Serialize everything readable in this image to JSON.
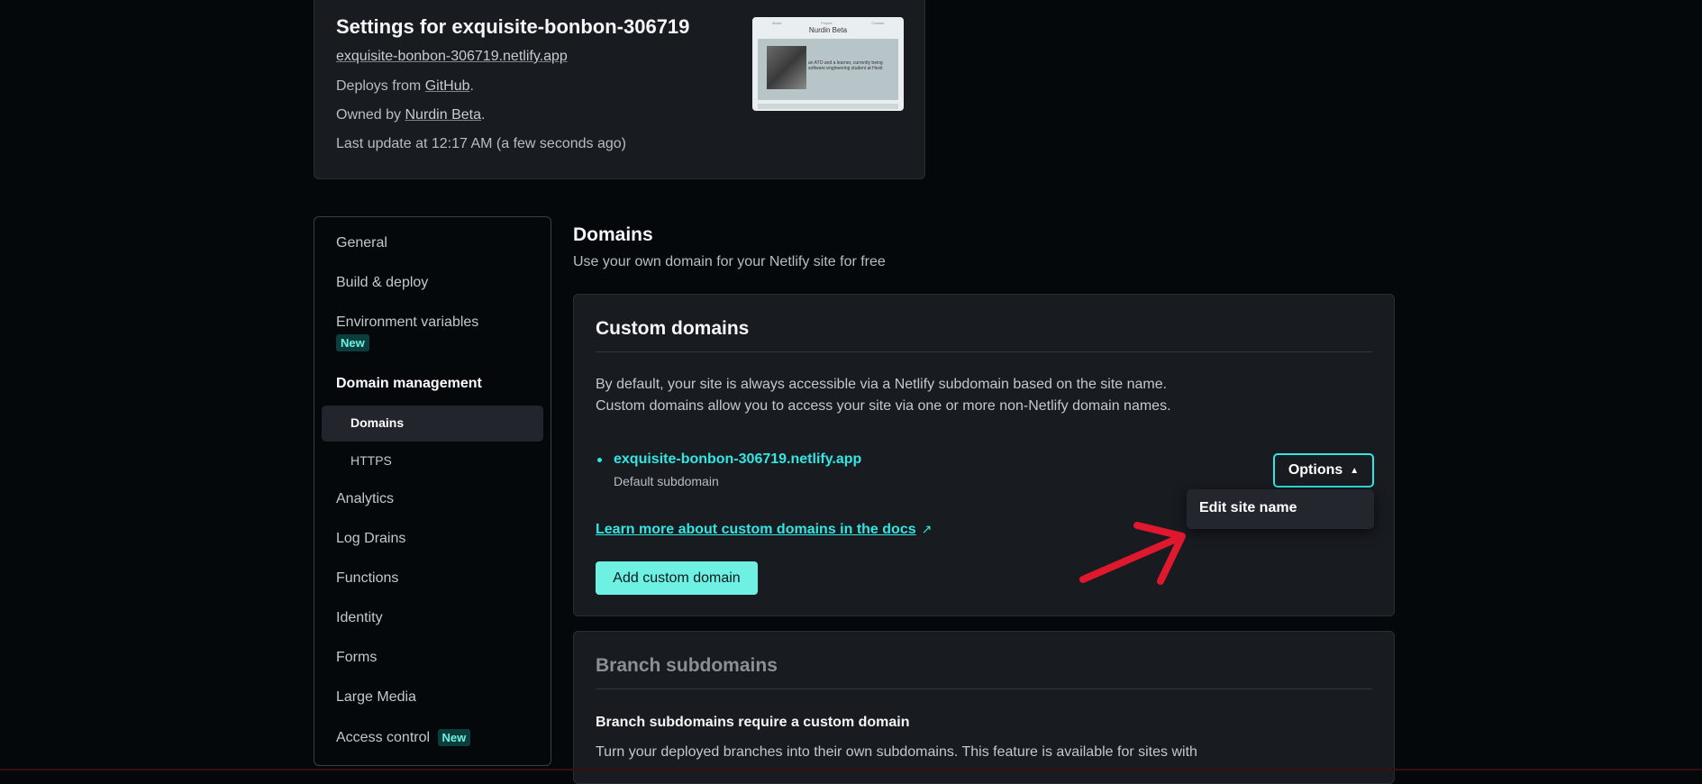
{
  "site": {
    "title": "Settings for exquisite-bonbon-306719",
    "url": "exquisite-bonbon-306719.netlify.app",
    "deploys_prefix": "Deploys from ",
    "deploys_source": "GitHub",
    "owned_prefix": "Owned by ",
    "owner": "Nurdin Beta",
    "period": ".",
    "last_update": "Last update at 12:17 AM (a few seconds ago)",
    "thumbnail": {
      "name": "Nurdin Beta",
      "nav": [
        "About",
        "Project",
        "Contact"
      ],
      "blurb": "an ATO and a learner, currently being software engineering student at Hexit"
    }
  },
  "sidebar": {
    "items": [
      {
        "label": "General"
      },
      {
        "label": "Build & deploy"
      },
      {
        "label": "Environment variables",
        "badge": "New"
      },
      {
        "label": "Domain management"
      },
      {
        "label": "Domains"
      },
      {
        "label": "HTTPS"
      },
      {
        "label": "Analytics"
      },
      {
        "label": "Log Drains"
      },
      {
        "label": "Functions"
      },
      {
        "label": "Identity"
      },
      {
        "label": "Forms"
      },
      {
        "label": "Large Media"
      },
      {
        "label": "Access control",
        "badge": "New"
      }
    ]
  },
  "main": {
    "title": "Domains",
    "subtitle": "Use your own domain for your Netlify site for free",
    "custom_domains": {
      "title": "Custom domains",
      "desc_line1": "By default, your site is always accessible via a Netlify subdomain based on the site name.",
      "desc_line2": "Custom domains allow you to access your site via one or more non-Netlify domain names.",
      "domain": "exquisite-bonbon-306719.netlify.app",
      "domain_note": "Default subdomain",
      "options_label": "Options",
      "menu_item": "Edit site name",
      "docs_link": "Learn more about custom domains in the docs",
      "add_button": "Add custom domain"
    },
    "branch_subdomains": {
      "title": "Branch subdomains",
      "subtitle": "Branch subdomains require a custom domain",
      "desc": "Turn your deployed branches into their own subdomains. This feature is available for sites with"
    }
  },
  "icons": {
    "external_link": "external-link-icon",
    "chevron_up": "chevron-up-icon"
  },
  "colors": {
    "accent": "#32e6e2",
    "button_bg": "#6ef1e3",
    "arrow": "#e0182d"
  }
}
